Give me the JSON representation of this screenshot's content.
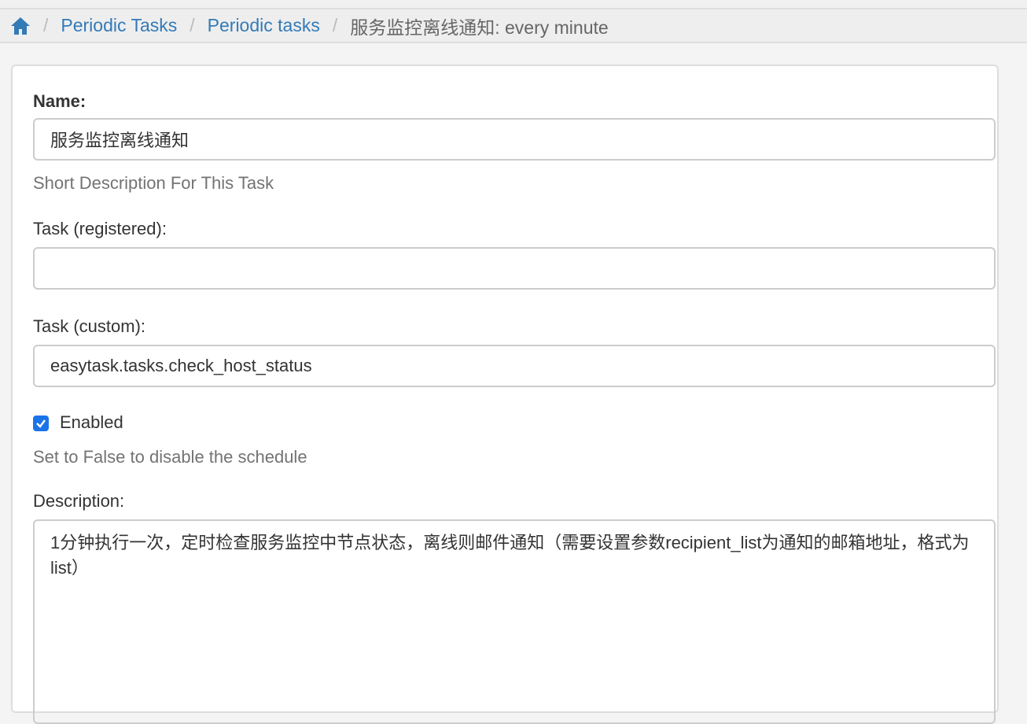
{
  "breadcrumb": {
    "items": [
      "Periodic Tasks",
      "Periodic tasks"
    ],
    "current": "服务监控离线通知: every minute"
  },
  "form": {
    "name": {
      "label": "Name:",
      "value": "服务监控离线通知",
      "help": "Short Description For This Task"
    },
    "task_registered": {
      "label": "Task (registered):",
      "value": ""
    },
    "task_custom": {
      "label": "Task (custom):",
      "value": "easytask.tasks.check_host_status"
    },
    "enabled": {
      "label": "Enabled",
      "checked": true,
      "help": "Set to False to disable the schedule"
    },
    "description": {
      "label": "Description:",
      "value": "1分钟执行一次，定时检查服务监控中节点状态，离线则邮件通知（需要设置参数recipient_list为通知的邮箱地址，格式为list）"
    }
  },
  "colors": {
    "link": "#337ab7",
    "checkbox": "#1a73e8"
  }
}
